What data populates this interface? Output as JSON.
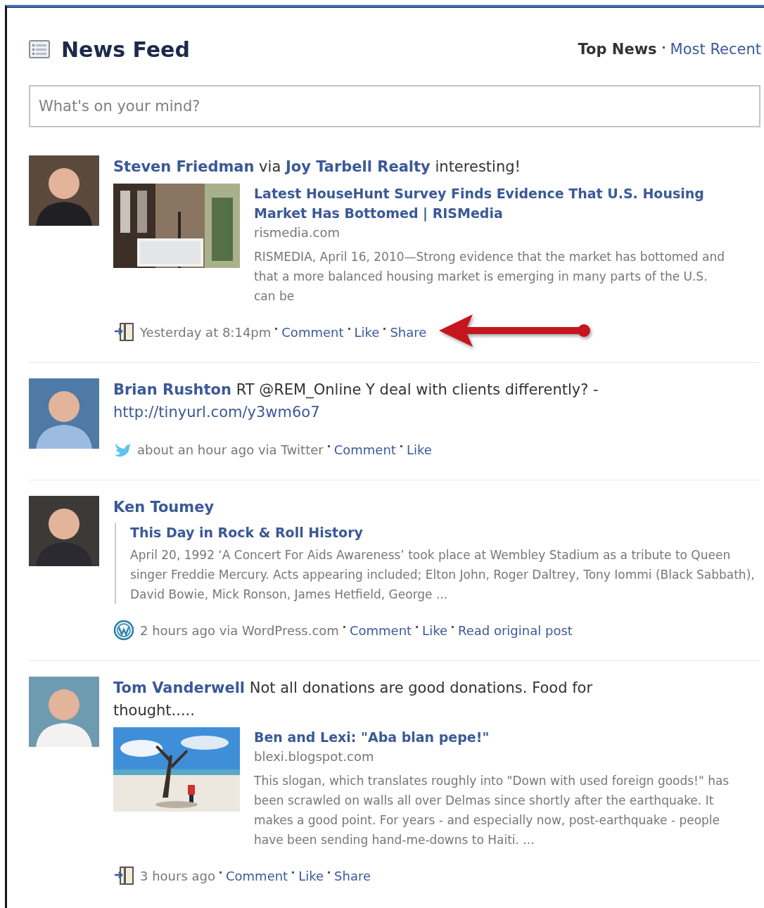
{
  "header": {
    "title": "News Feed",
    "tabs": [
      {
        "label": "Top News",
        "selected": true
      },
      {
        "label": "Most Recent",
        "selected": false
      }
    ]
  },
  "composer": {
    "placeholder": "What's on your mind?"
  },
  "stories": [
    {
      "author": "Steven Friedman",
      "via": "via",
      "via_page": "Joy Tarbell Realty",
      "message": "interesting!",
      "attachment": {
        "kind": "link",
        "title": "Latest HouseHunt Survey Finds Evidence That U.S. Housing Market Has Bottomed | RISMedia",
        "domain": "rismedia.com",
        "description": "RISMEDIA, April 16, 2010—Strong evidence that the market has bottomed and that a more balanced housing market is emerging in many parts of the U.S. can be"
      },
      "footer": {
        "kind": "share",
        "time": "Yesterday at 8:14pm",
        "actions": [
          "Comment",
          "Like",
          "Share"
        ]
      },
      "annotation": {
        "kind": "arrow"
      }
    },
    {
      "author": "Brian Rushton",
      "message": "RT @REM_Online Y deal with clients differently? -",
      "message_link": "http://tinyurl.com/y3wm6o7",
      "footer": {
        "kind": "bird",
        "time": "about an hour ago via Twitter",
        "actions": [
          "Comment",
          "Like"
        ]
      }
    },
    {
      "author": "Ken Toumey",
      "attachment": {
        "kind": "note",
        "title": "This Day in Rock & Roll History",
        "description": "April 20, 1992 ‘A Concert For Aids Awareness’ took place at Wembley Stadium as a tribute to Queen singer Freddie Mercury. Acts appearing included; Elton John, Roger Daltrey, Tony Iommi (Black Sabbath), David Bowie, Mick Ronson, James Hetfield, George ..."
      },
      "footer": {
        "kind": "circle",
        "time": "2 hours ago via WordPress.com",
        "actions": [
          "Comment",
          "Like",
          "Read original post"
        ]
      }
    },
    {
      "author": "Tom Vanderwell",
      "message": "Not all donations are good donations. Food for thought.....",
      "attachment": {
        "kind": "link",
        "title": "Ben and Lexi: \"Aba blan pepe!\"",
        "domain": "blexi.blogspot.com",
        "description": "This slogan, which translates roughly into \"Down with used foreign goods!\" has been scrawled on walls all over Delmas since shortly after the earthquake. It makes a good point. For years - and especially now, post-earthquake - people have been sending hand-me-downs to Haiti. ..."
      },
      "footer": {
        "kind": "share",
        "time": "3 hours ago",
        "actions": [
          "Comment",
          "Like",
          "Share"
        ]
      }
    }
  ]
}
